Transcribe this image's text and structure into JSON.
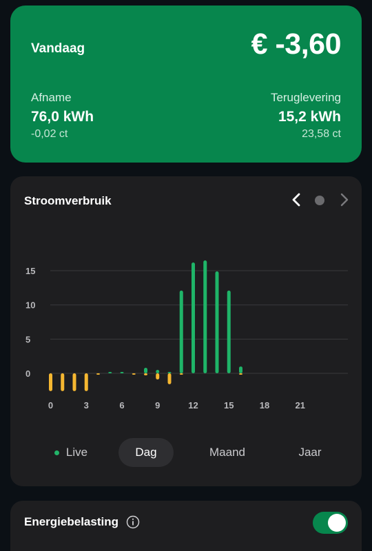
{
  "summary": {
    "title": "Vandaag",
    "total": "€ -3,60",
    "afname": {
      "label": "Afname",
      "value": "76,0 kWh",
      "sub": "-0,02 ct"
    },
    "teruglevering": {
      "label": "Teruglevering",
      "value": "15,2 kWh",
      "sub": "23,58 ct"
    }
  },
  "chart_card": {
    "title": "Stroomverbruik"
  },
  "periods": {
    "live": "Live",
    "dag": "Dag",
    "maand": "Maand",
    "jaar": "Jaar",
    "selected": "Dag"
  },
  "tax": {
    "label": "Energiebelasting",
    "enabled": true
  },
  "colors": {
    "brand_green": "#07864d",
    "return_green": "#1fb468",
    "consumption_yellow": "#f5b731",
    "card_bg": "#1e1e20",
    "page_bg": "#0b1015"
  },
  "icons": {
    "prev": "chevron-left-icon",
    "next": "chevron-right-icon",
    "info": "info-icon"
  },
  "chart_data": {
    "type": "bar",
    "title": "Stroomverbruik",
    "xlabel": "",
    "ylabel": "",
    "x_ticks": [
      "0",
      "3",
      "6",
      "9",
      "12",
      "15",
      "18",
      "21"
    ],
    "y_ticks": [
      "0",
      "5",
      "10",
      "15"
    ],
    "ylim": [
      -3.5,
      17.5
    ],
    "grid": true,
    "series": [
      {
        "kind": "return",
        "color": "#1fb468",
        "points": [
          {
            "x": 5,
            "y": 0.1
          },
          {
            "x": 6,
            "y": 0.1
          },
          {
            "x": 8,
            "y": 0.8
          },
          {
            "x": 9,
            "y": 0.5
          },
          {
            "x": 10,
            "y": 0.2
          },
          {
            "x": 11,
            "y": 12.1
          },
          {
            "x": 12,
            "y": 16.2
          },
          {
            "x": 13,
            "y": 16.5
          },
          {
            "x": 14,
            "y": 14.9
          },
          {
            "x": 15,
            "y": 12.1
          },
          {
            "x": 16,
            "y": 1.0
          }
        ]
      },
      {
        "kind": "consumption",
        "color": "#f5b731",
        "points": [
          {
            "x": 0,
            "y": -2.6
          },
          {
            "x": 1,
            "y": -2.6
          },
          {
            "x": 2,
            "y": -2.6
          },
          {
            "x": 3,
            "y": -2.6
          },
          {
            "x": 4,
            "y": -0.2
          },
          {
            "x": 7,
            "y": -0.2
          },
          {
            "x": 8,
            "y": -0.3
          },
          {
            "x": 9,
            "y": -0.9
          },
          {
            "x": 10,
            "y": -1.6
          },
          {
            "x": 11,
            "y": -0.2
          },
          {
            "x": 16,
            "y": -0.2
          }
        ]
      }
    ]
  }
}
